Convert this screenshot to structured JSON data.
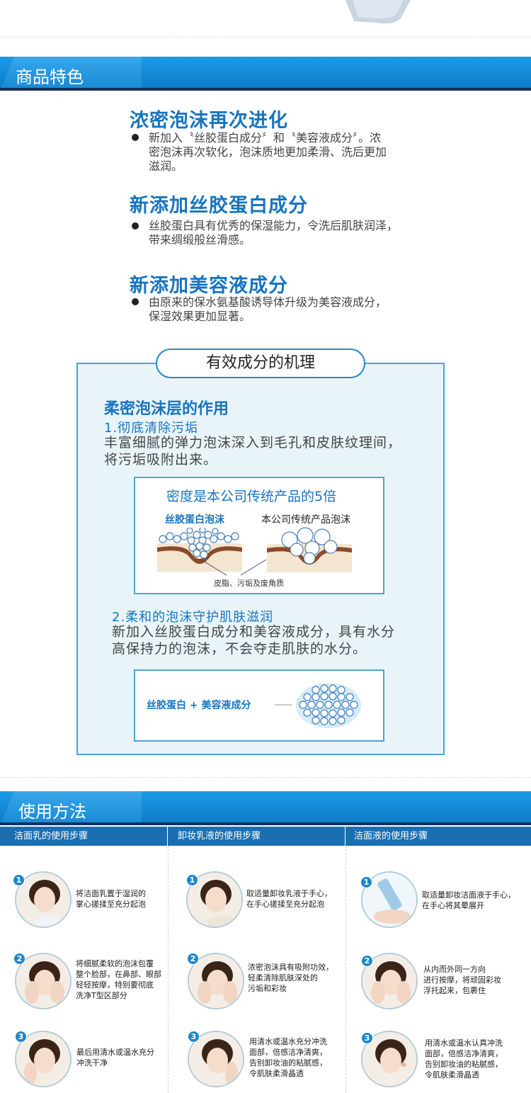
{
  "sections": {
    "features_title": "商品特色",
    "usage_title": "使用方法"
  },
  "features": [
    {
      "title": "浓密泡沫再次进化",
      "lines": [
        "新加入〝丝胶蛋白成分〞和〝美容液成分〞。浓",
        "密泡沫再次软化，泡沫质地更加柔滑、洗后更加",
        "滋润。"
      ]
    },
    {
      "title": "新添加丝胶蛋白成分",
      "lines": [
        "丝胶蛋白具有优秀的保湿能力，令洗后肌肤润泽，",
        "带来绸缎般丝滑感。"
      ]
    },
    {
      "title": "新添加美容液成分",
      "lines": [
        "由原来的保水氨基酸诱导体升级为美容液成分，",
        "保湿效果更加显著。"
      ]
    }
  ],
  "mechanism": {
    "pill": "有效成分的机理",
    "heading": "柔密泡沫层的作用",
    "point1": "1.彻底清除污垢",
    "point1_lines": [
      "丰富细腻的弹力泡沫深入到毛孔和皮肤纹理间，",
      "将污垢吸附出来。"
    ],
    "box1_title": "密度是本公司传统产品的5倍",
    "foam_label_left": "丝胶蛋白泡沫",
    "foam_label_right": "本公司传统产品泡沫",
    "foam_caption": "皮脂、污垢及废角质",
    "point2": "2.柔和的泡沫守护肌肤滋润",
    "point2_lines": [
      "新加入丝胶蛋白成分和美容液成分，具有水分",
      "高保持力的泡沫，不会夺走肌肤的水分。"
    ],
    "box2_text": "丝胶蛋白 + 美容液成分"
  },
  "usage": {
    "columns": [
      {
        "title": "洁面乳的使用步骤",
        "steps": [
          {
            "num": "1",
            "lines": [
              "将洁面乳置于湿润的",
              "掌心搓揉至充分起泡"
            ]
          },
          {
            "num": "2",
            "lines": [
              "将细腻柔软的泡沫包覆",
              "整个脸部，在鼻部、眼部",
              "轻轻按摩，特别要彻底",
              "洗净T型区部分"
            ]
          },
          {
            "num": "3",
            "lines": [
              "最后用清水或温水充分",
              "冲洗干净"
            ]
          }
        ]
      },
      {
        "title": "卸妆乳液的使用步骤",
        "steps": [
          {
            "num": "1",
            "lines": [
              "取适量卸妆乳液于手心，",
              "在手心搓揉至充分起泡"
            ]
          },
          {
            "num": "2",
            "lines": [
              "浓密泡沫具有吸附功效，",
              "轻柔清除肌肤深处的",
              "污垢和彩妆"
            ]
          },
          {
            "num": "3",
            "lines": [
              "用清水或温水充分冲洗",
              "面部，倍感洁净清爽，",
              "告别卸妆油的粘腻感，",
              "令肌肤柔滑晶透"
            ]
          }
        ]
      },
      {
        "title": "洁面液的使用步骤",
        "steps": [
          {
            "num": "1",
            "lines": [
              "取适量卸妆洁面液于手心，",
              "在手心将其晕展开"
            ]
          },
          {
            "num": "2",
            "lines": [
              "从内而外同一方向",
              "进行按摩，将顽固彩妆",
              "浮托起来，包裹住"
            ]
          },
          {
            "num": "3",
            "lines": [
              "用清水或温水认真冲洗",
              "面部，倍感洁净清爽，",
              "告别卸妆油的粘腻感，",
              "令肌肤柔滑晶透"
            ]
          }
        ]
      }
    ]
  }
}
